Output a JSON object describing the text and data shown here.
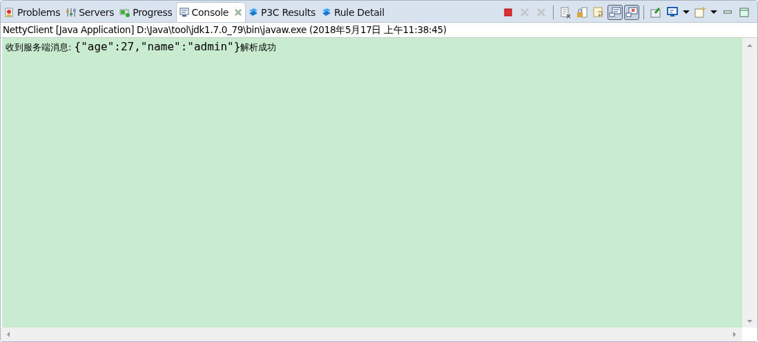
{
  "tabs": [
    {
      "label": "Problems",
      "kind": "problems",
      "selected": false,
      "closable": false
    },
    {
      "label": "Servers",
      "kind": "servers",
      "selected": false,
      "closable": false
    },
    {
      "label": "Progress",
      "kind": "progress",
      "selected": false,
      "closable": false
    },
    {
      "label": "Console",
      "kind": "console",
      "selected": true,
      "closable": true
    },
    {
      "label": "P3C Results",
      "kind": "p3c",
      "selected": false,
      "closable": false
    },
    {
      "label": "Rule Detail",
      "kind": "p3c",
      "selected": false,
      "closable": false
    }
  ],
  "toolbar": [
    {
      "kind": "terminate",
      "disabled": false,
      "pressed": false
    },
    {
      "kind": "remove",
      "disabled": true,
      "pressed": false
    },
    {
      "kind": "remove-all",
      "disabled": true,
      "pressed": false
    },
    {
      "kind": "separator"
    },
    {
      "kind": "clear",
      "disabled": false,
      "pressed": false
    },
    {
      "kind": "scroll-lock",
      "disabled": false,
      "pressed": false
    },
    {
      "kind": "word-wrap",
      "disabled": false,
      "pressed": false
    },
    {
      "kind": "show-stdout",
      "disabled": false,
      "pressed": true
    },
    {
      "kind": "show-stderr",
      "disabled": false,
      "pressed": true
    },
    {
      "kind": "separator"
    },
    {
      "kind": "pin",
      "disabled": false,
      "pressed": false
    },
    {
      "kind": "display",
      "disabled": false,
      "pressed": false
    },
    {
      "kind": "dropdown",
      "disabled": false,
      "pressed": false
    },
    {
      "kind": "new-console",
      "disabled": false,
      "pressed": false
    },
    {
      "kind": "dropdown",
      "disabled": false,
      "pressed": false
    },
    {
      "kind": "minimize",
      "disabled": false,
      "pressed": false
    },
    {
      "kind": "maximize",
      "disabled": false,
      "pressed": false
    }
  ],
  "console": {
    "title": "NettyClient [Java Application] D:\\Java\\tool\\jdk1.7.0_79\\bin\\javaw.exe (2018年5月17日 上午11:38:45)",
    "lines": [
      [
        {
          "kind": "cjk",
          "text": "收到服务端消息: "
        },
        {
          "kind": "mono",
          "text": "{\"age\":27,\"name\":\"admin\"}"
        },
        {
          "kind": "cjk",
          "text": "解析成功"
        }
      ]
    ]
  }
}
